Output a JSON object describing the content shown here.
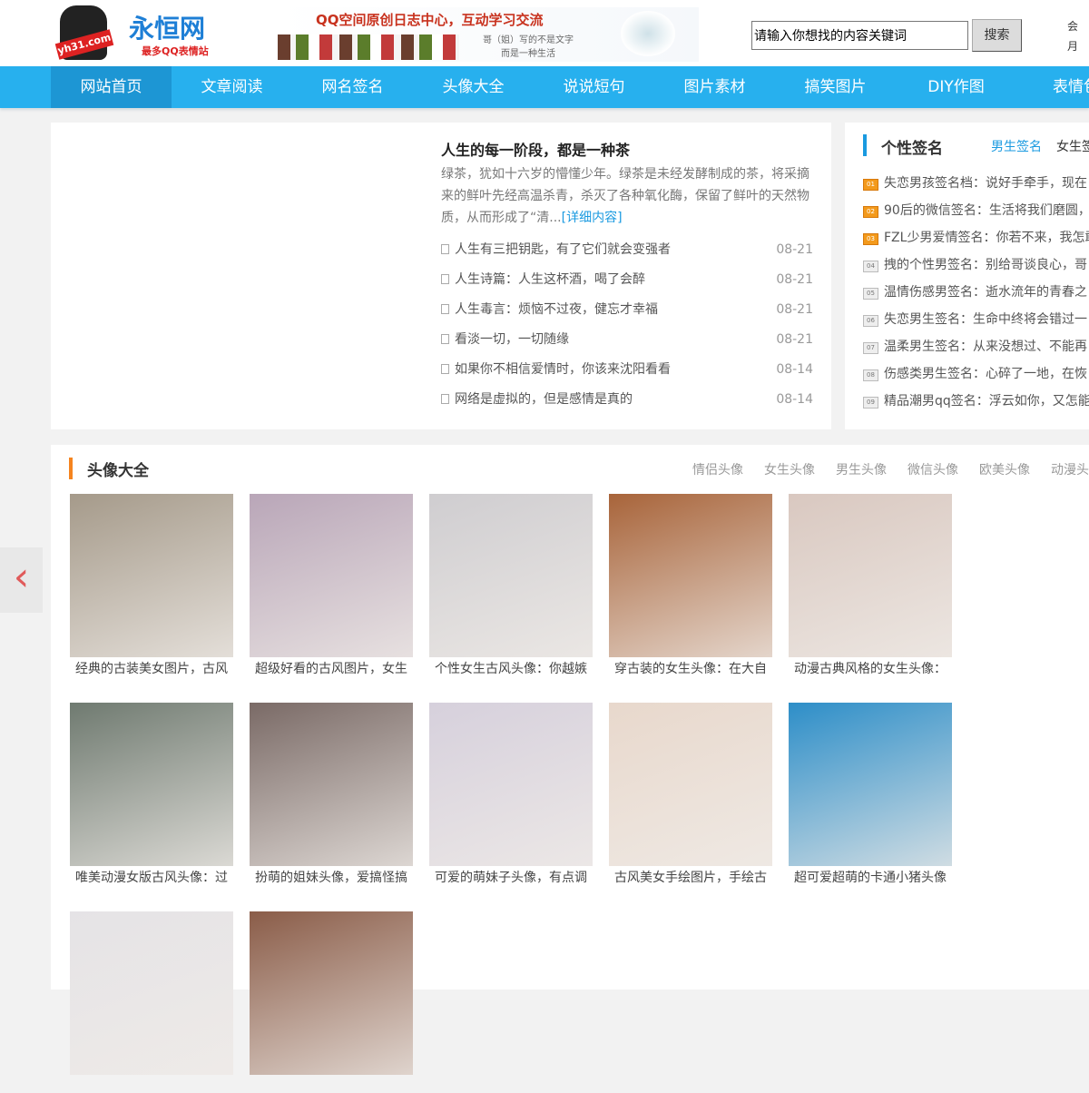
{
  "header": {
    "logo_badge": "yh31.com",
    "logo_name": "永恒网",
    "logo_slogan": "最多QQ表情站",
    "banner_title": "QQ空间原创日志中心，互动学习交流",
    "banner_line1": "哥（姐）写的不是文字",
    "banner_line2": "而是一种生活",
    "search_value": "请输入你想找的内容关键词",
    "search_button": "搜索",
    "user_link1": "会",
    "user_link2": "月"
  },
  "nav": [
    "网站首页",
    "文章阅读",
    "网名签名",
    "头像大全",
    "说说短句",
    "图片素材",
    "搞笑图片",
    "DIY作图",
    "表情包"
  ],
  "featured": {
    "title": "人生的每一阶段，都是一种茶",
    "summary": "绿茶，犹如十六岁的懵懂少年。绿茶是未经发酵制成的茶，将采摘来的鲜叶先经高温杀青，杀灭了各种氧化酶，保留了鲜叶的天然物质，从而形成了“清...",
    "more": "[详细内容]"
  },
  "articles": [
    {
      "title": "人生有三把钥匙，有了它们就会变强者",
      "date": "08-21"
    },
    {
      "title": "人生诗篇：人生这杯酒，喝了会醉",
      "date": "08-21"
    },
    {
      "title": "人生毒言：烦恼不过夜，健忘才幸福",
      "date": "08-21"
    },
    {
      "title": "看淡一切，一切随缘",
      "date": "08-21"
    },
    {
      "title": "如果你不相信爱情时，你该来沈阳看看",
      "date": "08-14"
    },
    {
      "title": "网络是虚拟的，但是感情是真的",
      "date": "08-14"
    }
  ],
  "signatures": {
    "title": "个性签名",
    "tab_active": "男生签名",
    "tab_other": "女生签名",
    "items": [
      {
        "num": "01",
        "text": "失恋男孩签名档：说好手牵手，现在"
      },
      {
        "num": "02",
        "text": "90后的微信签名：生活将我们磨圆，"
      },
      {
        "num": "03",
        "text": "FZL少男爱情签名：你若不来，我怎敢"
      },
      {
        "num": "04",
        "text": "拽的个性男签名：别给哥谈良心，哥"
      },
      {
        "num": "05",
        "text": "温情伤感男签名：逝水流年的青春之"
      },
      {
        "num": "06",
        "text": "失恋男生签名：生命中终将会错过一"
      },
      {
        "num": "07",
        "text": "温柔男生签名：从来没想过、不能再"
      },
      {
        "num": "08",
        "text": "伤感类男生签名：心碎了一地，在恢"
      },
      {
        "num": "09",
        "text": "精品潮男qq签名：浮云如你，又怎能"
      }
    ]
  },
  "avatars": {
    "title": "头像大全",
    "tabs": [
      "情侣头像",
      "女生头像",
      "男生头像",
      "微信头像",
      "欧美头像",
      "动漫头像"
    ],
    "items": [
      {
        "caption": "经典的古装美女图片，古风",
        "color": "#a59a8a"
      },
      {
        "caption": "超级好看的古风图片，女生",
        "color": "#b9a6b8"
      },
      {
        "caption": "个性女生古风头像：你越嫉",
        "color": "#cfcdd0"
      },
      {
        "caption": "穿古装的女生头像：在大自",
        "color": "#a8643a"
      },
      {
        "caption": "动漫古典风格的女生头像：",
        "color": "#d9c8c0"
      },
      {
        "caption": "唯美动漫女版古风头像：过",
        "color": "#6f7a70"
      },
      {
        "caption": "扮萌的姐妹头像，爱搞怪搞",
        "color": "#7a6a66"
      },
      {
        "caption": "可爱的萌妹子头像，有点调",
        "color": "#d6d0dc"
      },
      {
        "caption": "古风美女手绘图片，手绘古",
        "color": "#e8d8cc"
      },
      {
        "caption": "超可爱超萌的卡通小猪头像",
        "color": "#2d8ec8"
      },
      {
        "caption": "",
        "color": "#e5e3e6"
      },
      {
        "caption": "",
        "color": "#8a5c48"
      }
    ]
  },
  "carousel_prev": "‹"
}
